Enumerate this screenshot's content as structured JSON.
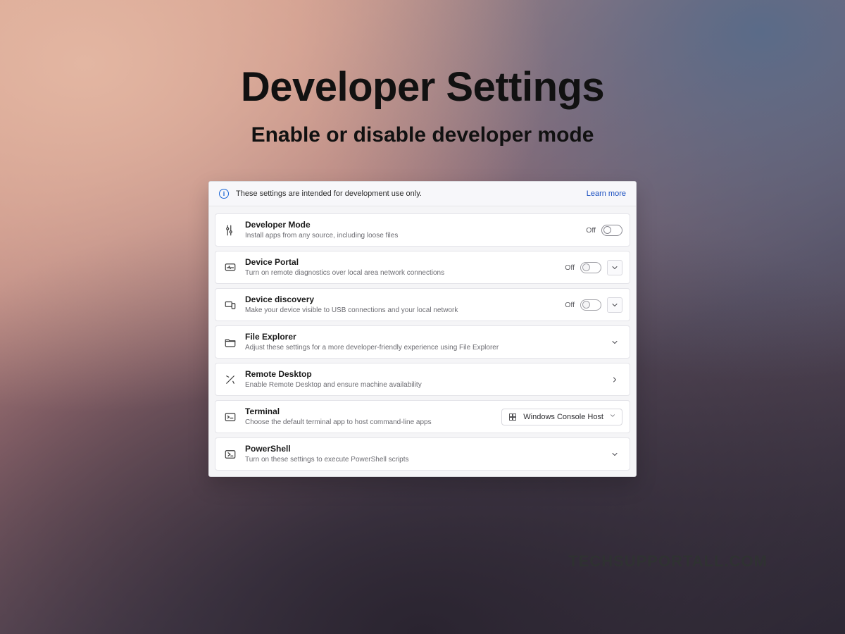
{
  "hero": {
    "title": "Developer Settings",
    "subtitle": "Enable or disable developer mode"
  },
  "info": {
    "text": "These settings are intended for development use only.",
    "learn_more": "Learn more"
  },
  "rows": {
    "developer_mode": {
      "title": "Developer Mode",
      "desc": "Install apps from any source, including loose files",
      "toggle_label": "Off"
    },
    "device_portal": {
      "title": "Device Portal",
      "desc": "Turn on remote diagnostics over local area network connections",
      "toggle_label": "Off"
    },
    "device_discovery": {
      "title": "Device discovery",
      "desc": "Make your device visible to USB connections and your local network",
      "toggle_label": "Off"
    },
    "file_explorer": {
      "title": "File Explorer",
      "desc": "Adjust these settings for a more developer-friendly experience using File Explorer"
    },
    "remote_desktop": {
      "title": "Remote Desktop",
      "desc": "Enable Remote Desktop and ensure machine availability"
    },
    "terminal": {
      "title": "Terminal",
      "desc": "Choose the default terminal app to host command-line apps",
      "select_value": "Windows Console Host"
    },
    "powershell": {
      "title": "PowerShell",
      "desc": "Turn on these settings to execute PowerShell scripts"
    }
  },
  "watermark": "TECHSUPPORTALL.COM"
}
